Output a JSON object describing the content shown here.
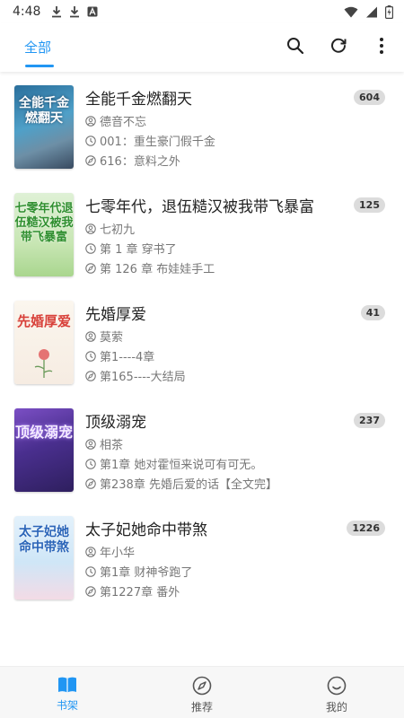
{
  "status_bar": {
    "time": "4:48"
  },
  "tabs": [
    {
      "label": "全部",
      "active": true
    }
  ],
  "books": [
    {
      "title": "全能千金燃翻天",
      "count": "604",
      "author": "德音不忘",
      "last_read": "001：重生豪门假千金",
      "latest": "616：意料之外",
      "cover_text": "全能千金燃翻天"
    },
    {
      "title": "七零年代，退伍糙汉被我带飞暴富",
      "count": "125",
      "author": "七初九",
      "last_read": "第 1 章 穿书了",
      "latest": "第 126 章 布娃娃手工",
      "cover_text": "七零年代退伍糙汉被我带飞暴富"
    },
    {
      "title": "先婚厚爱",
      "count": "41",
      "author": "莫萦",
      "last_read": "第1----4章",
      "latest": "第165----大结局",
      "cover_text": "先婚厚爱"
    },
    {
      "title": "顶级溺宠",
      "count": "237",
      "author": "相茶",
      "last_read": "第1章 她对霍恒来说可有可无。",
      "latest": "第238章 先婚后爱的话【全文完】",
      "cover_text": "顶级溺宠"
    },
    {
      "title": "太子妃她命中带煞",
      "count": "1226",
      "author": "年小华",
      "last_read": "第1章 财神爷跑了",
      "latest": "第1227章 番外",
      "cover_text": "太子妃她命中带煞"
    }
  ],
  "bottom_nav": [
    {
      "label": "书架",
      "icon": "book-icon",
      "active": true
    },
    {
      "label": "推荐",
      "icon": "compass-icon",
      "active": false
    },
    {
      "label": "我的",
      "icon": "smiley-icon",
      "active": false
    }
  ],
  "colors": {
    "accent": "#2196f3",
    "badge_bg": "#dcdcdc",
    "meta_text": "#777777"
  }
}
